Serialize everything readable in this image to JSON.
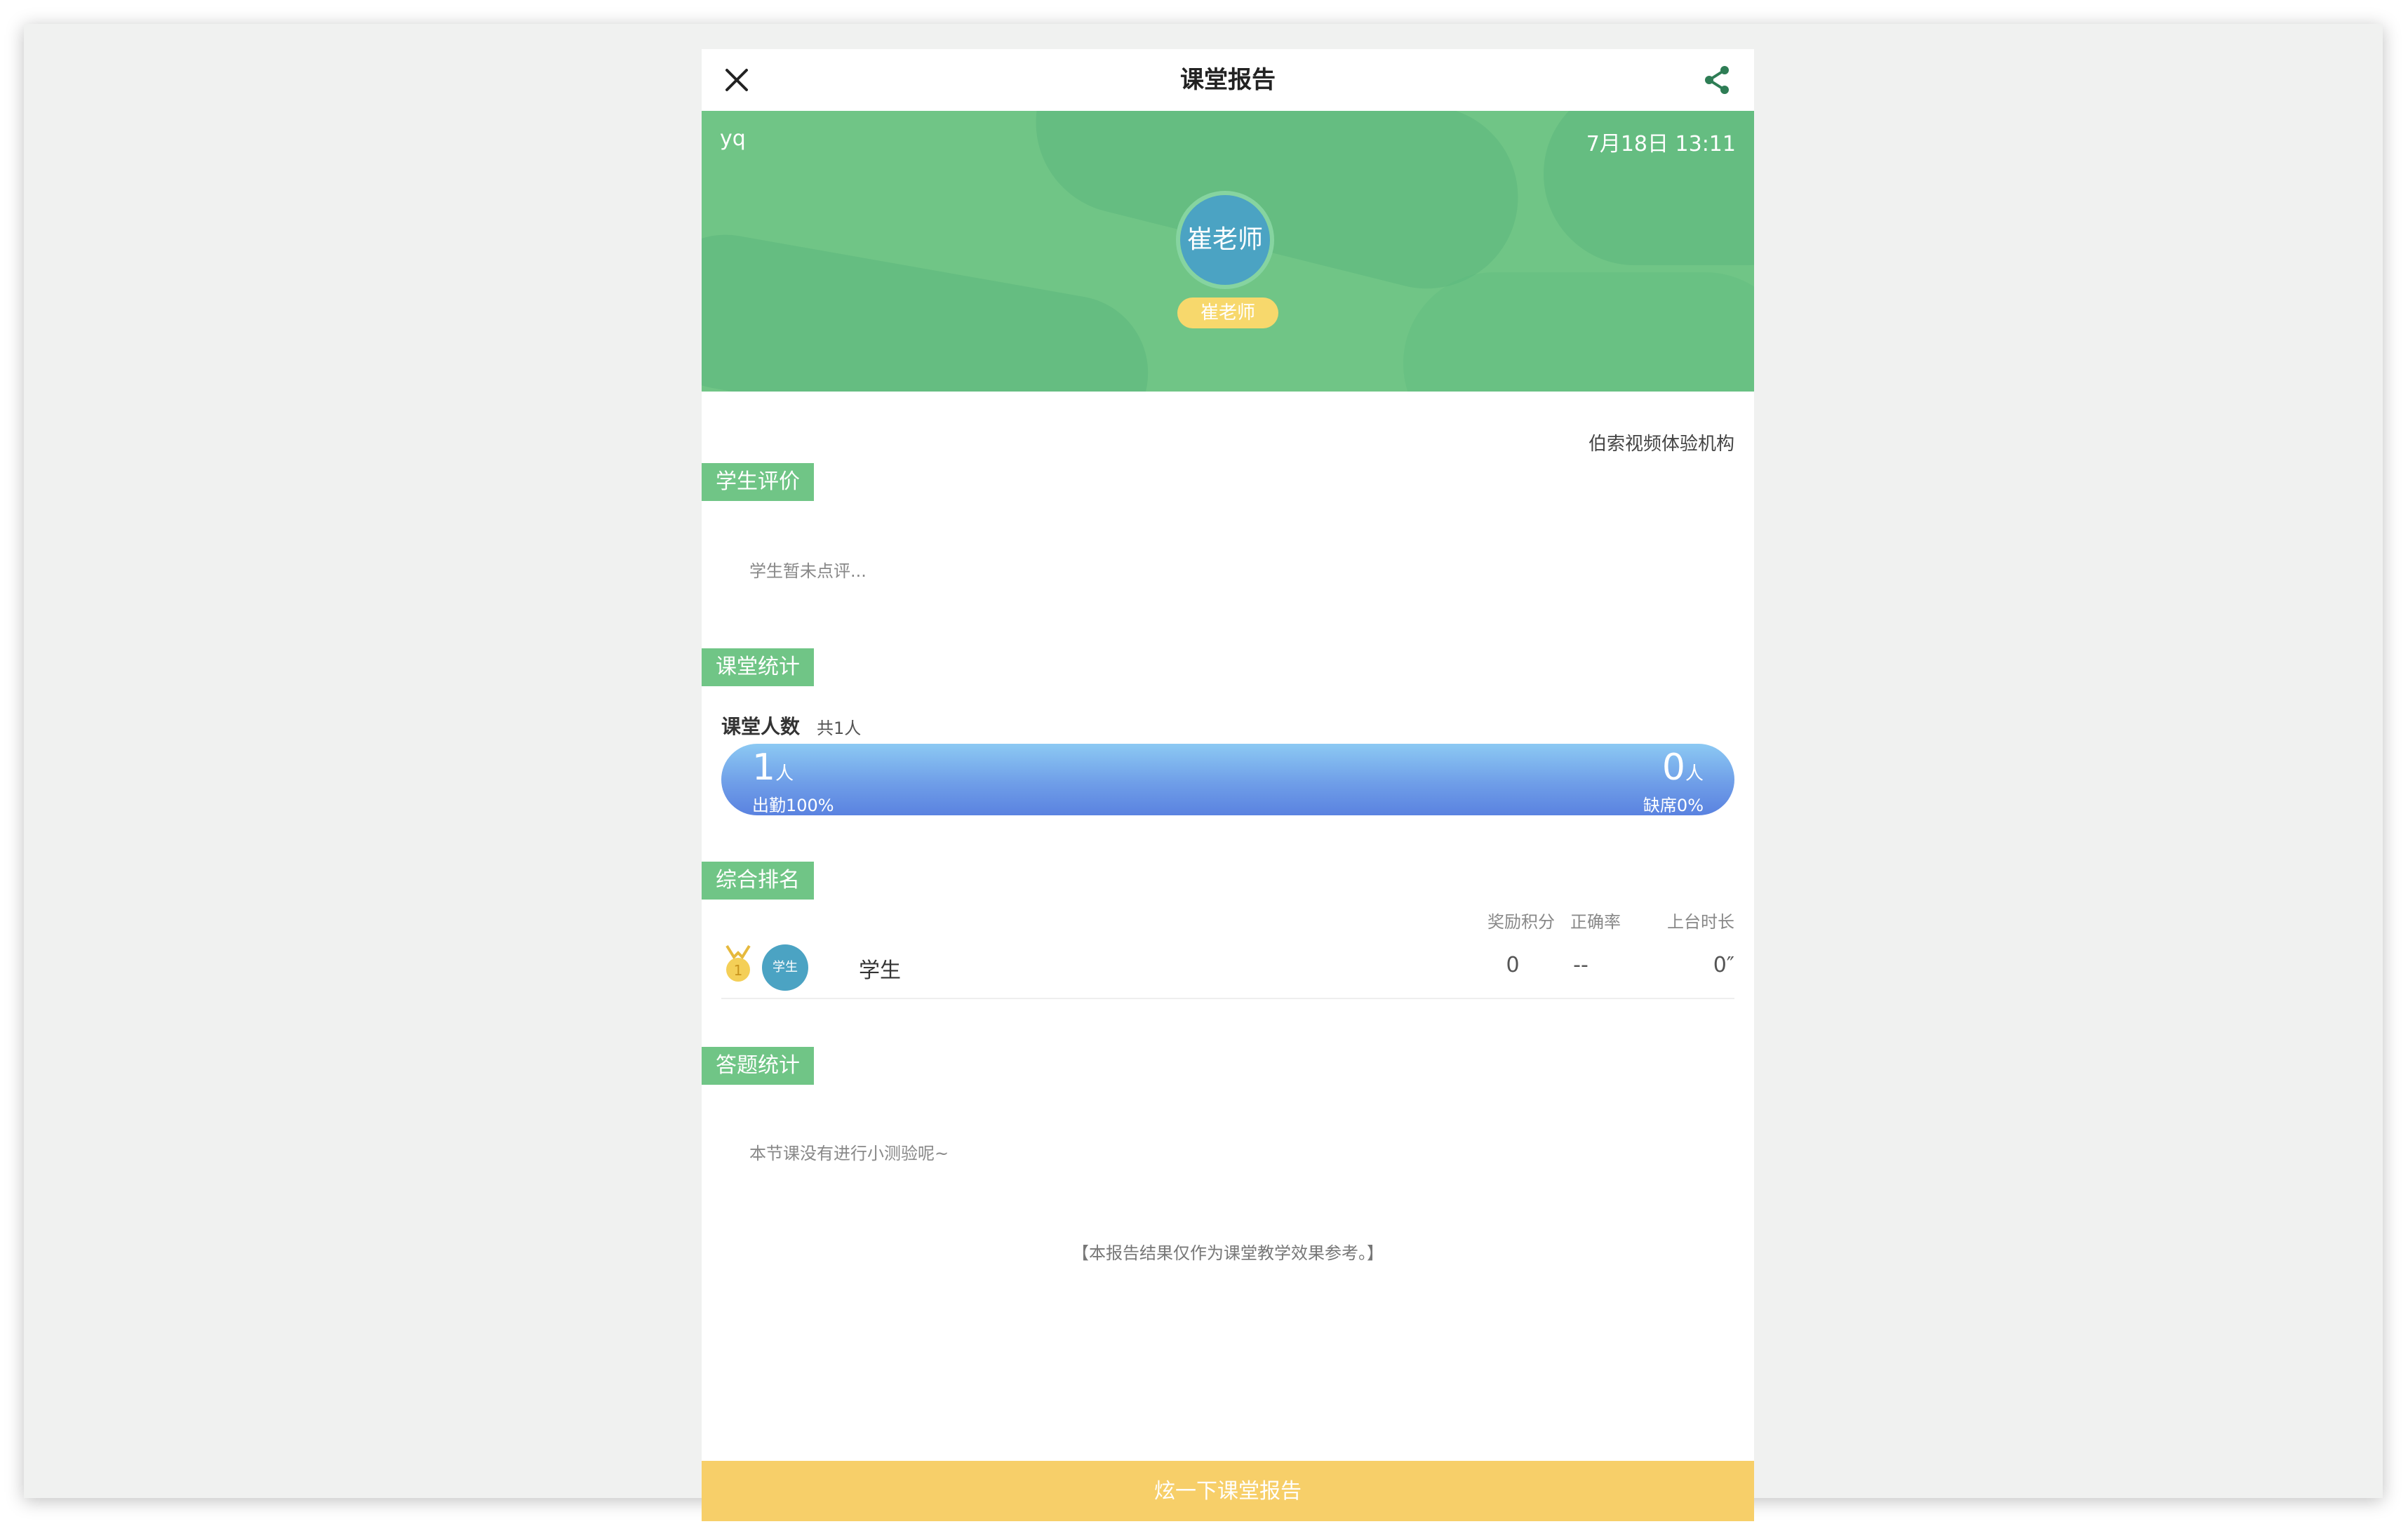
{
  "header": {
    "title": "课堂报告",
    "close_icon": "close-icon",
    "share_icon": "share-icon"
  },
  "hero": {
    "user": "yq",
    "datetime": "7月18日 13:11",
    "avatar_text": "崔老师",
    "teacher_badge": "崔老师",
    "bg_color": "#70c586"
  },
  "institution": "伯索视频体验机构",
  "student_eval": {
    "tag": "学生评价",
    "placeholder": "学生暂未点评..."
  },
  "class_stats": {
    "tag": "课堂统计",
    "count_label": "课堂人数",
    "count_total": "共1人",
    "present_num": "1",
    "present_unit": "人",
    "present_label": "出勤100%",
    "absent_num": "0",
    "absent_unit": "人",
    "absent_label": "缺席0%",
    "attendance_rate": 1.0
  },
  "ranking": {
    "tag": "综合排名",
    "columns": [
      "奖励积分",
      "正确率",
      "上台时长"
    ],
    "rows": [
      {
        "rank": "1",
        "avatar": "学生",
        "name": "学生",
        "points": "0",
        "accuracy": "--",
        "stage_time": "0″"
      }
    ]
  },
  "answer_stats": {
    "tag": "答题统计",
    "placeholder": "本节课没有进行小测验呢~"
  },
  "footer_note": "【本报告结果仅作为课堂教学效果参考。】",
  "cta_label": "炫一下课堂报告",
  "colors": {
    "accent_green": "#70c586",
    "cta_yellow": "#f7cf69",
    "bar_blue": "#6f9ee8",
    "avatar_blue": "#4ba3c3"
  }
}
